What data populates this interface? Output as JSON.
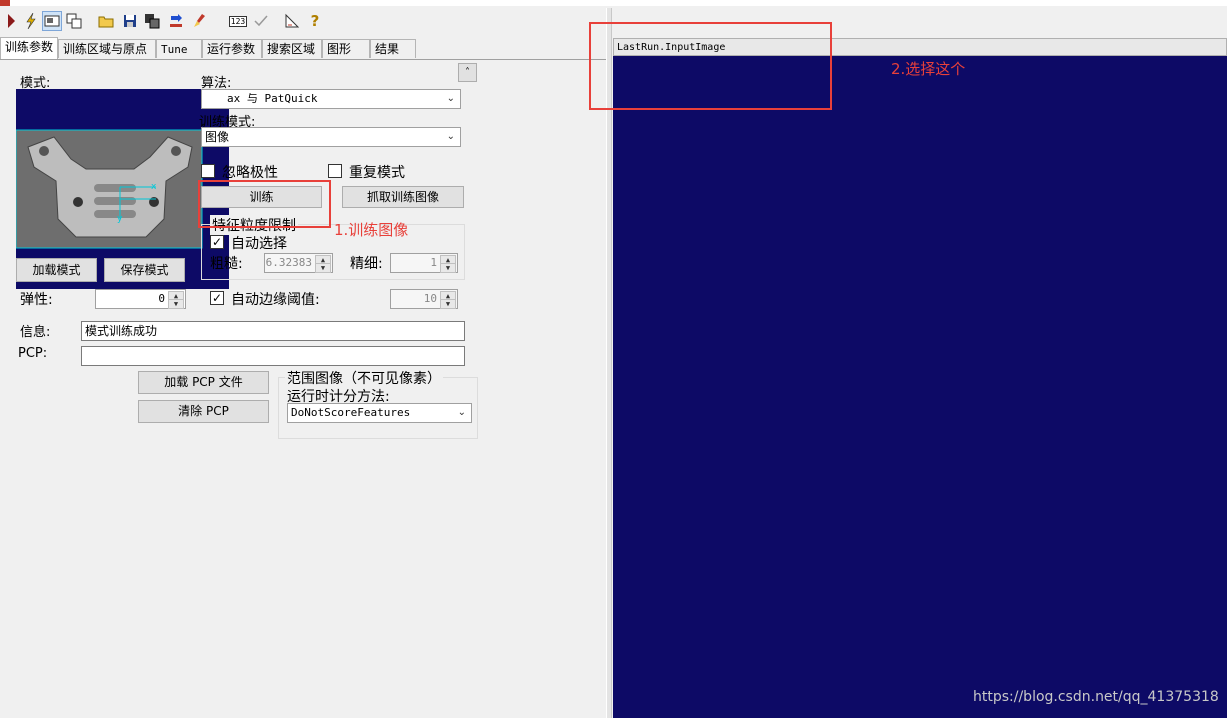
{
  "toolbar": {
    "icons": [
      "run-icon",
      "electric-icon",
      "display-icon",
      "copy-icon",
      "open-folder-icon",
      "save-icon",
      "save-as-icon",
      "import-icon",
      "clear-icon",
      "numeric-icon",
      "check-icon",
      "ruler-icon",
      "help-icon"
    ],
    "numeric_text": "123"
  },
  "tabs": [
    "训练参数",
    "训练区域与原点",
    "Tune",
    "运行参数",
    "搜索区域",
    "图形",
    "结果"
  ],
  "left": {
    "mode_label": "模式:",
    "algo_label": "算法:",
    "algo_value": "ax 与 PatQuick",
    "train_mode_label": "训练模式:",
    "train_mode_value": "图像",
    "ignore_polarity": "忽略极性",
    "repeat_mode": "重复模式",
    "train_btn": "训练",
    "grab_btn": "抓取训练图像",
    "feature_group": "特征粒度限制",
    "auto_select": "自动选择",
    "coarse_label": "粗糙:",
    "coarse_value": "6.32383",
    "fine_label": "精细:",
    "fine_value": "1",
    "load_mode_btn": "加载模式",
    "save_mode_btn": "保存模式",
    "elasticity_label": "弹性:",
    "elasticity_value": "0",
    "auto_edge": "自动边缘阈值:",
    "edge_value": "10",
    "info_label": "信息:",
    "info_value": "模式训练成功",
    "pcp_label": "PCP:",
    "pcp_value": "",
    "load_pcp_btn": "加载 PCP 文件",
    "clear_pcp_btn": "清除 PCP",
    "range_group": "范围图像（不可见像素）",
    "runtime_label": "运行时计分方法:",
    "runtime_value": "DoNotScoreFeatures"
  },
  "right": {
    "image_title": "LastRun.InputImage"
  },
  "annotations": {
    "step1": "1.训练图像",
    "step2": "2.选择这个"
  },
  "watermark": "https://blog.csdn.net/qq_41375318",
  "colors": {
    "image_bg": "#0d0a66",
    "annotation": "#e8403a",
    "overlay": "#00c8d8"
  }
}
